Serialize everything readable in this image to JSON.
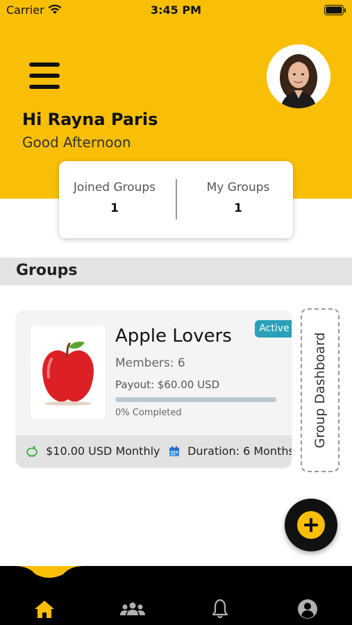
{
  "status_bar": {
    "carrier": "Carrier",
    "time": "3:45 PM"
  },
  "header": {
    "greeting_name": "Hi Rayna Paris",
    "greeting_time": "Good Afternoon"
  },
  "stats": {
    "joined_label": "Joined Groups",
    "joined_value": "1",
    "my_label": "My Groups",
    "my_value": "1"
  },
  "section": {
    "title": "Groups"
  },
  "groups": [
    {
      "name": "Apple Lovers",
      "status": "Active",
      "members": "Members: 6",
      "payout": "Payout: $60.00 USD",
      "progress": 0,
      "completed": "0% Completed",
      "contribution": "$10.00 USD Monthly",
      "duration": "Duration: 6 Months",
      "thumbnail_icon": "apple-icon"
    }
  ],
  "dashboard_button": {
    "label": "Group Dashboard"
  },
  "tabs": [
    {
      "icon": "home-icon",
      "active": true
    },
    {
      "icon": "people-icon",
      "active": false
    },
    {
      "icon": "bell-icon",
      "active": false
    },
    {
      "icon": "profile-icon",
      "active": false
    }
  ],
  "colors": {
    "brand": "#f9bf06",
    "accent": "#2aa1b8",
    "tab_bar": "#000000"
  }
}
